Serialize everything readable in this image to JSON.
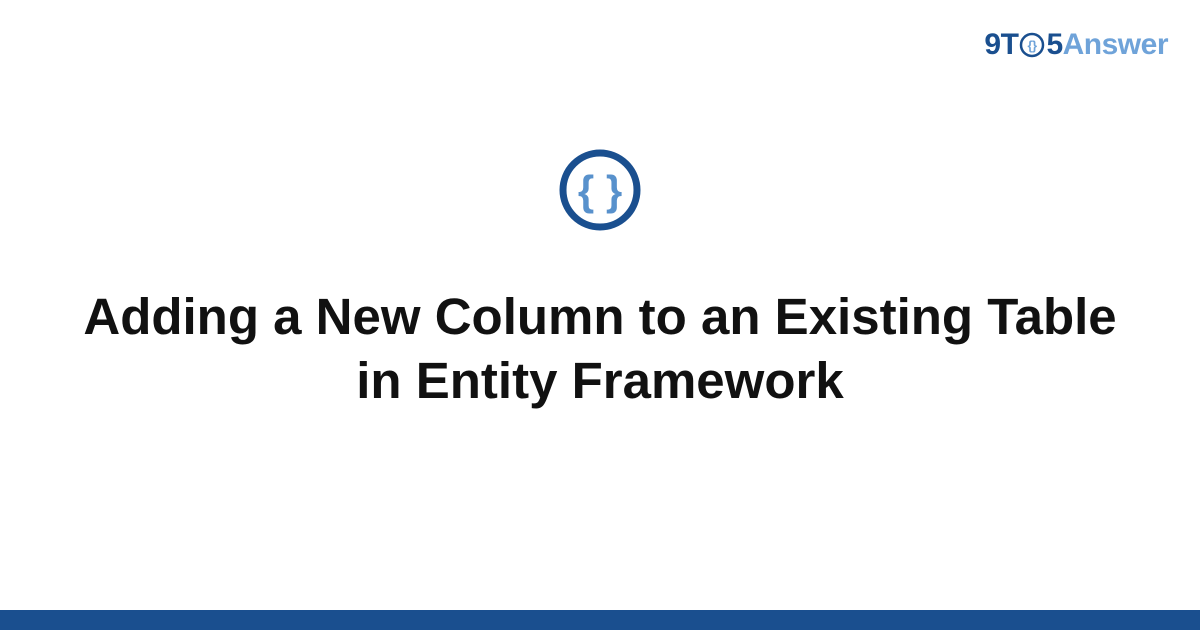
{
  "logo": {
    "part1": "9T",
    "part2": "5",
    "part3": "Answer"
  },
  "page": {
    "title": "Adding a New Column to an Existing Table in Entity Framework"
  },
  "colors": {
    "brand_dark": "#1a4f8f",
    "brand_light": "#6fa3d9"
  },
  "icon": {
    "topic": "code-braces-icon"
  }
}
